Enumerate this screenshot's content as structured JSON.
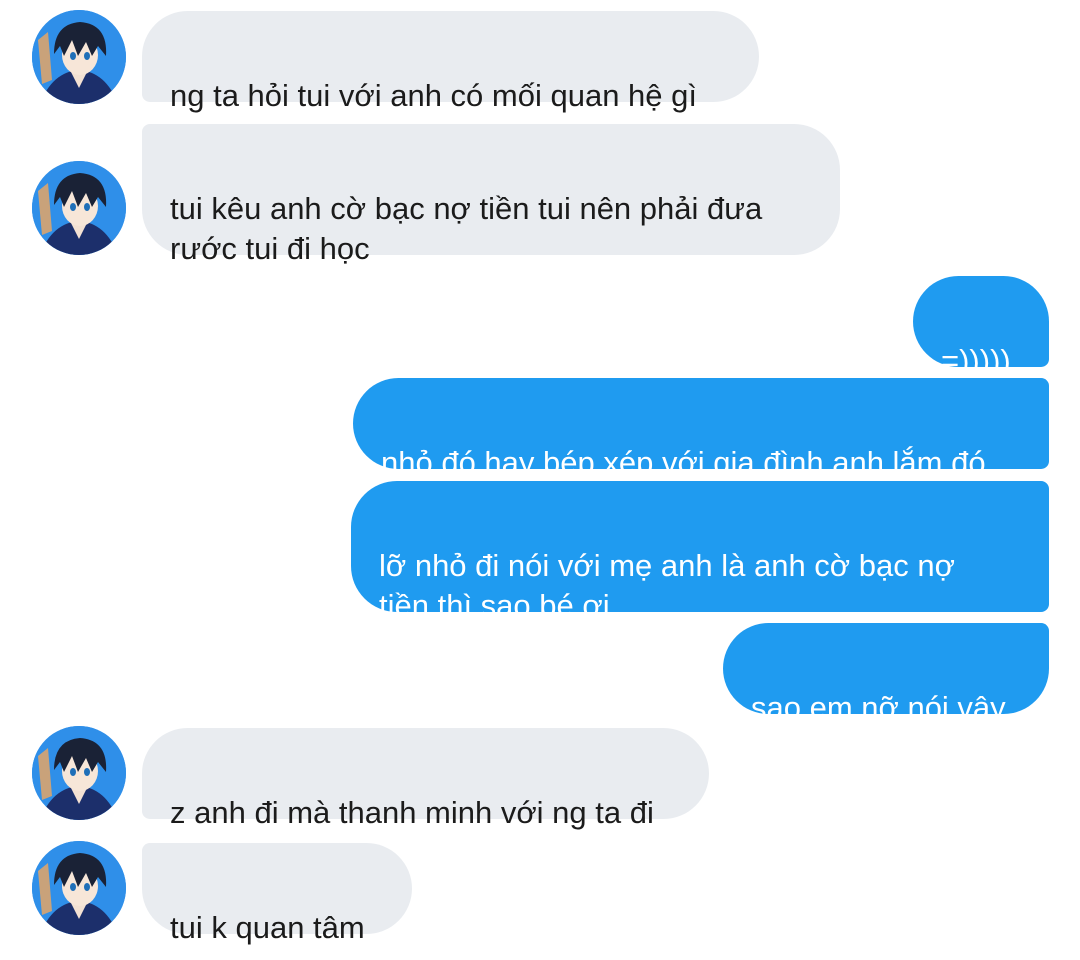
{
  "messages": [
    {
      "sender": "other",
      "text": "ng ta hỏi tui với anh có mối quan hệ gì"
    },
    {
      "sender": "other",
      "text": "tui kêu anh cờ bạc nợ tiền tui nên phải đưa\nrước tui đi học"
    },
    {
      "sender": "self",
      "text": "=)))))"
    },
    {
      "sender": "self",
      "text": "nhỏ đó hay bép xép với gia đình anh lắm đó"
    },
    {
      "sender": "self",
      "text": "lỡ nhỏ đi nói với mẹ anh là anh cờ bạc nợ\ntiền thì sao bé ơi"
    },
    {
      "sender": "self",
      "text": "sao em nỡ nói vậy"
    },
    {
      "sender": "other",
      "text": "z anh đi mà thanh minh với ng ta đi"
    },
    {
      "sender": "other",
      "text": "tui k quan tâm"
    }
  ],
  "colors": {
    "incoming_bubble": "#e9ecf0",
    "outgoing_bubble": "#1f9bf0",
    "avatar_bg": "#2f8fe9"
  },
  "avatar_icon": "anime-character-avatar-icon"
}
